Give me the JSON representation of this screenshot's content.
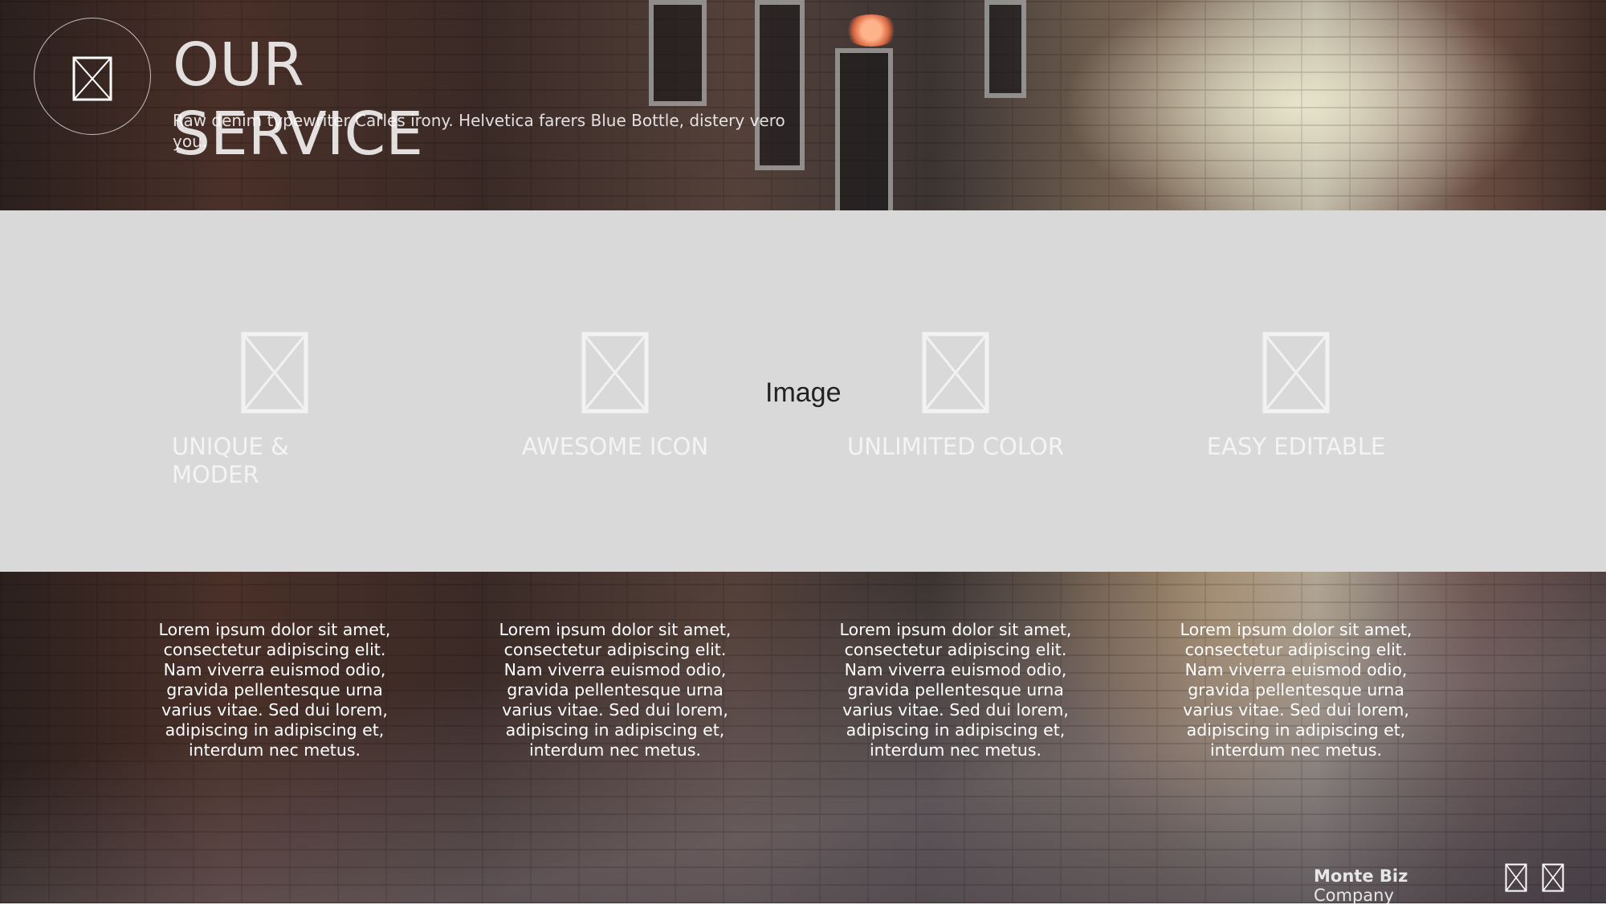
{
  "header": {
    "title": "OUR SERVICE",
    "subtitle": "Raw denim typewriter Carles irony. Helvetica farers Blue Bottle, distery vero you."
  },
  "band": {
    "label": "Image"
  },
  "features": [
    {
      "title": "UNIQUE & MODER",
      "description": "Lorem ipsum dolor sit amet, consectetur adipiscing elit. Nam viverra euismod odio, gravida pellentesque urna varius vitae. Sed dui lorem, adipiscing in adipiscing et, interdum nec metus."
    },
    {
      "title": "AWESOME ICON",
      "description": "Lorem ipsum dolor sit amet, consectetur adipiscing elit. Nam viverra euismod odio, gravida pellentesque urna varius vitae. Sed dui lorem, adipiscing in adipiscing et, interdum nec metus."
    },
    {
      "title": "UNLIMITED COLOR",
      "description": "Lorem ipsum dolor sit amet, consectetur adipiscing elit. Nam viverra euismod odio, gravida pellentesque urna varius vitae. Sed dui lorem, adipiscing in adipiscing et, interdum nec metus."
    },
    {
      "title": "EASY EDITABLE",
      "description": "Lorem ipsum dolor sit amet, consectetur adipiscing elit. Nam viverra euismod odio, gravida pellentesque urna varius vitae. Sed dui lorem, adipiscing in adipiscing et, interdum nec metus."
    }
  ],
  "footer": {
    "brand_name": "Monte Biz",
    "brand_sub": "Company"
  },
  "icons": {
    "placeholder": "image-placeholder-icon"
  },
  "colors": {
    "band": "#d9d9d9",
    "text": "#ffffff"
  }
}
